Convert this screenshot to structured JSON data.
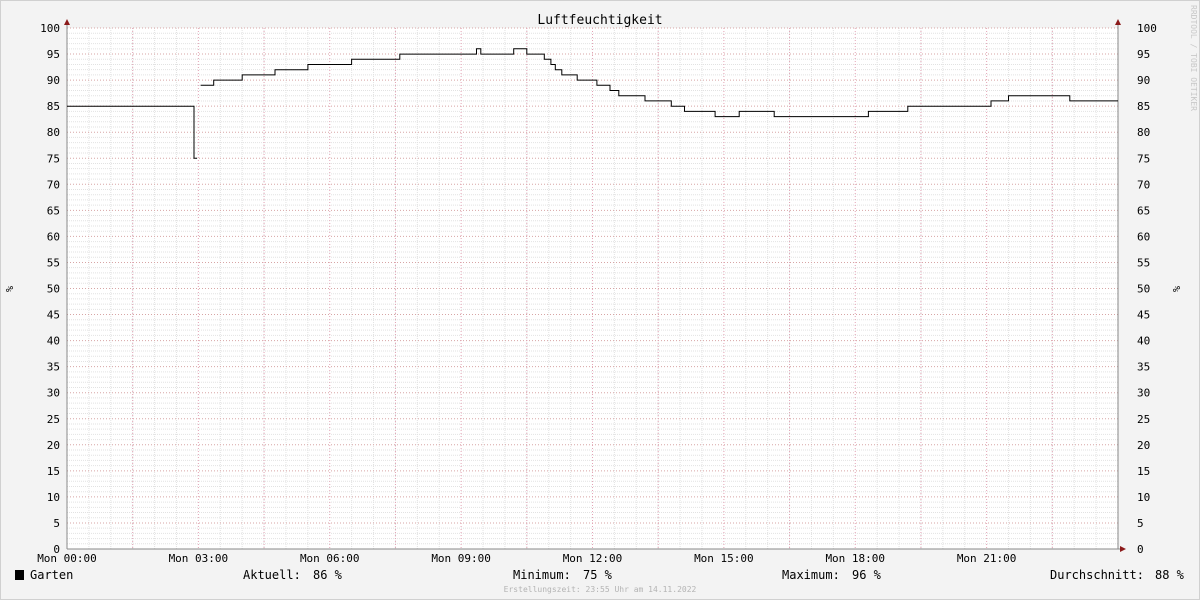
{
  "chart_data": {
    "type": "line",
    "title": "Luftfeuchtigkeit",
    "ylabel": "%",
    "ylim": [
      0,
      100
    ],
    "yticks": [
      0,
      5,
      10,
      15,
      20,
      25,
      30,
      35,
      40,
      45,
      50,
      55,
      60,
      65,
      70,
      75,
      80,
      85,
      90,
      95,
      100
    ],
    "xlim_hours": [
      0,
      24
    ],
    "xticks": [
      {
        "hour": 0,
        "label": "Mon 00:00"
      },
      {
        "hour": 3,
        "label": "Mon 03:00"
      },
      {
        "hour": 6,
        "label": "Mon 06:00"
      },
      {
        "hour": 9,
        "label": "Mon 09:00"
      },
      {
        "hour": 12,
        "label": "Mon 12:00"
      },
      {
        "hour": 15,
        "label": "Mon 15:00"
      },
      {
        "hour": 18,
        "label": "Mon 18:00"
      },
      {
        "hour": 21,
        "label": "Mon 21:00"
      }
    ],
    "grid": true,
    "watermark": "RRDTOOL / TOBI OETIKER",
    "series": [
      {
        "name": "Garten",
        "color": "#000000",
        "step": true,
        "points": [
          [
            0.0,
            85
          ],
          [
            2.9,
            75
          ],
          [
            2.97,
            null
          ],
          [
            3.05,
            89
          ],
          [
            3.35,
            90
          ],
          [
            4.0,
            91
          ],
          [
            4.75,
            92
          ],
          [
            5.5,
            93
          ],
          [
            6.5,
            94
          ],
          [
            7.6,
            95
          ],
          [
            9.35,
            96
          ],
          [
            9.45,
            95
          ],
          [
            10.2,
            96
          ],
          [
            10.5,
            95
          ],
          [
            10.9,
            94
          ],
          [
            11.05,
            93
          ],
          [
            11.15,
            92
          ],
          [
            11.3,
            91
          ],
          [
            11.65,
            90
          ],
          [
            12.1,
            89
          ],
          [
            12.4,
            88
          ],
          [
            12.6,
            87
          ],
          [
            13.2,
            86
          ],
          [
            13.8,
            85
          ],
          [
            14.1,
            84
          ],
          [
            14.8,
            83
          ],
          [
            15.35,
            84
          ],
          [
            16.15,
            83
          ],
          [
            18.3,
            84
          ],
          [
            19.2,
            85
          ],
          [
            21.1,
            86
          ],
          [
            21.5,
            87
          ],
          [
            22.9,
            86
          ],
          [
            24.0,
            86
          ]
        ]
      }
    ]
  },
  "legend": {
    "series_name": "Garten",
    "aktuell_label": "Aktuell:",
    "aktuell_value": "86 %",
    "minimum_label": "Minimum:",
    "minimum_value": "75 %",
    "maximum_label": "Maximum:",
    "maximum_value": "96 %",
    "durchschnitt_label": "Durchschnitt:",
    "durchschnitt_value": "88 %",
    "swatch_color": "#000000"
  },
  "footer": {
    "created_text": "Erstellungszeit: 23:55 Uhr am 14.11.2022"
  }
}
